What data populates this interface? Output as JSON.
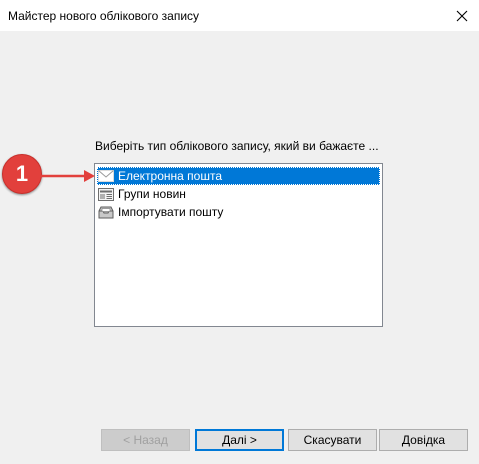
{
  "window": {
    "title": "Майстер нового облікового запису"
  },
  "prompt": "Виберіть тип облікового запису, який ви бажаєте ...",
  "account_types": [
    {
      "label": "Електронна пошта",
      "icon": "envelope-icon",
      "selected": true
    },
    {
      "label": "Групи новин",
      "icon": "newsgroup-icon",
      "selected": false
    },
    {
      "label": "Імпортувати пошту",
      "icon": "import-mail-icon",
      "selected": false
    }
  ],
  "annotation": {
    "number": "1",
    "color": "#e2403c"
  },
  "buttons": {
    "back": "< Назад",
    "next": "Далі >",
    "cancel": "Скасувати",
    "help": "Довідка"
  },
  "colors": {
    "selection": "#0078d7",
    "default_button_border": "#0078d7"
  }
}
